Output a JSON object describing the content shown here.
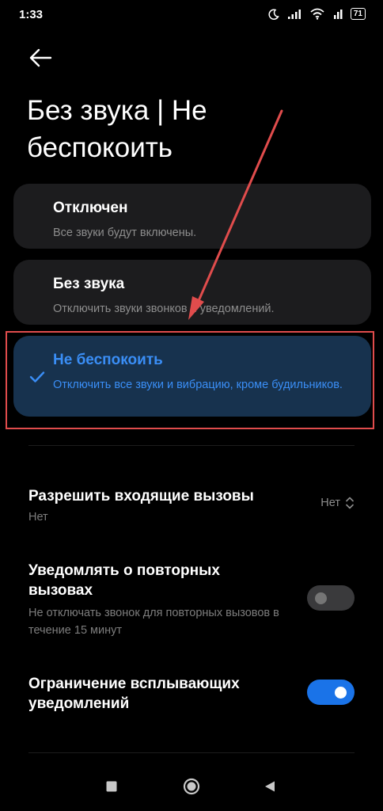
{
  "status": {
    "time": "1:33",
    "battery": "71"
  },
  "header": {
    "title": "Без звука | Не беспокоить"
  },
  "modes": [
    {
      "title": "Отключен",
      "description": "Все звуки будут включены."
    },
    {
      "title": "Без звука",
      "description": "Отключить звуки звонков и уведомлений."
    },
    {
      "title": "Не беспокоить",
      "description": "Отключить все звуки и вибрацию, кроме будильников.",
      "selected": true
    }
  ],
  "settings": {
    "calls": {
      "title": "Разрешить входящие вызовы",
      "subtitle": "Нет",
      "value": "Нет"
    },
    "repeat": {
      "title": "Уведомлять о повторных вызовах",
      "subtitle": "Не отключать звонок для повторных вызовов в течение 15 минут",
      "enabled": false
    },
    "popup": {
      "title": "Ограничение всплывающих уведомлений",
      "enabled": true
    }
  },
  "colors": {
    "accent": "#3a8ef6",
    "toggle_on": "#1a73e8",
    "annotation": "#e04c4c"
  },
  "icons": [
    "back-arrow-icon",
    "moon-icon",
    "signal-icon",
    "wifi-icon",
    "battery-icon",
    "checkmark-icon",
    "chevron-updown-icon",
    "square-nav-icon",
    "circle-nav-icon",
    "triangle-nav-icon"
  ]
}
